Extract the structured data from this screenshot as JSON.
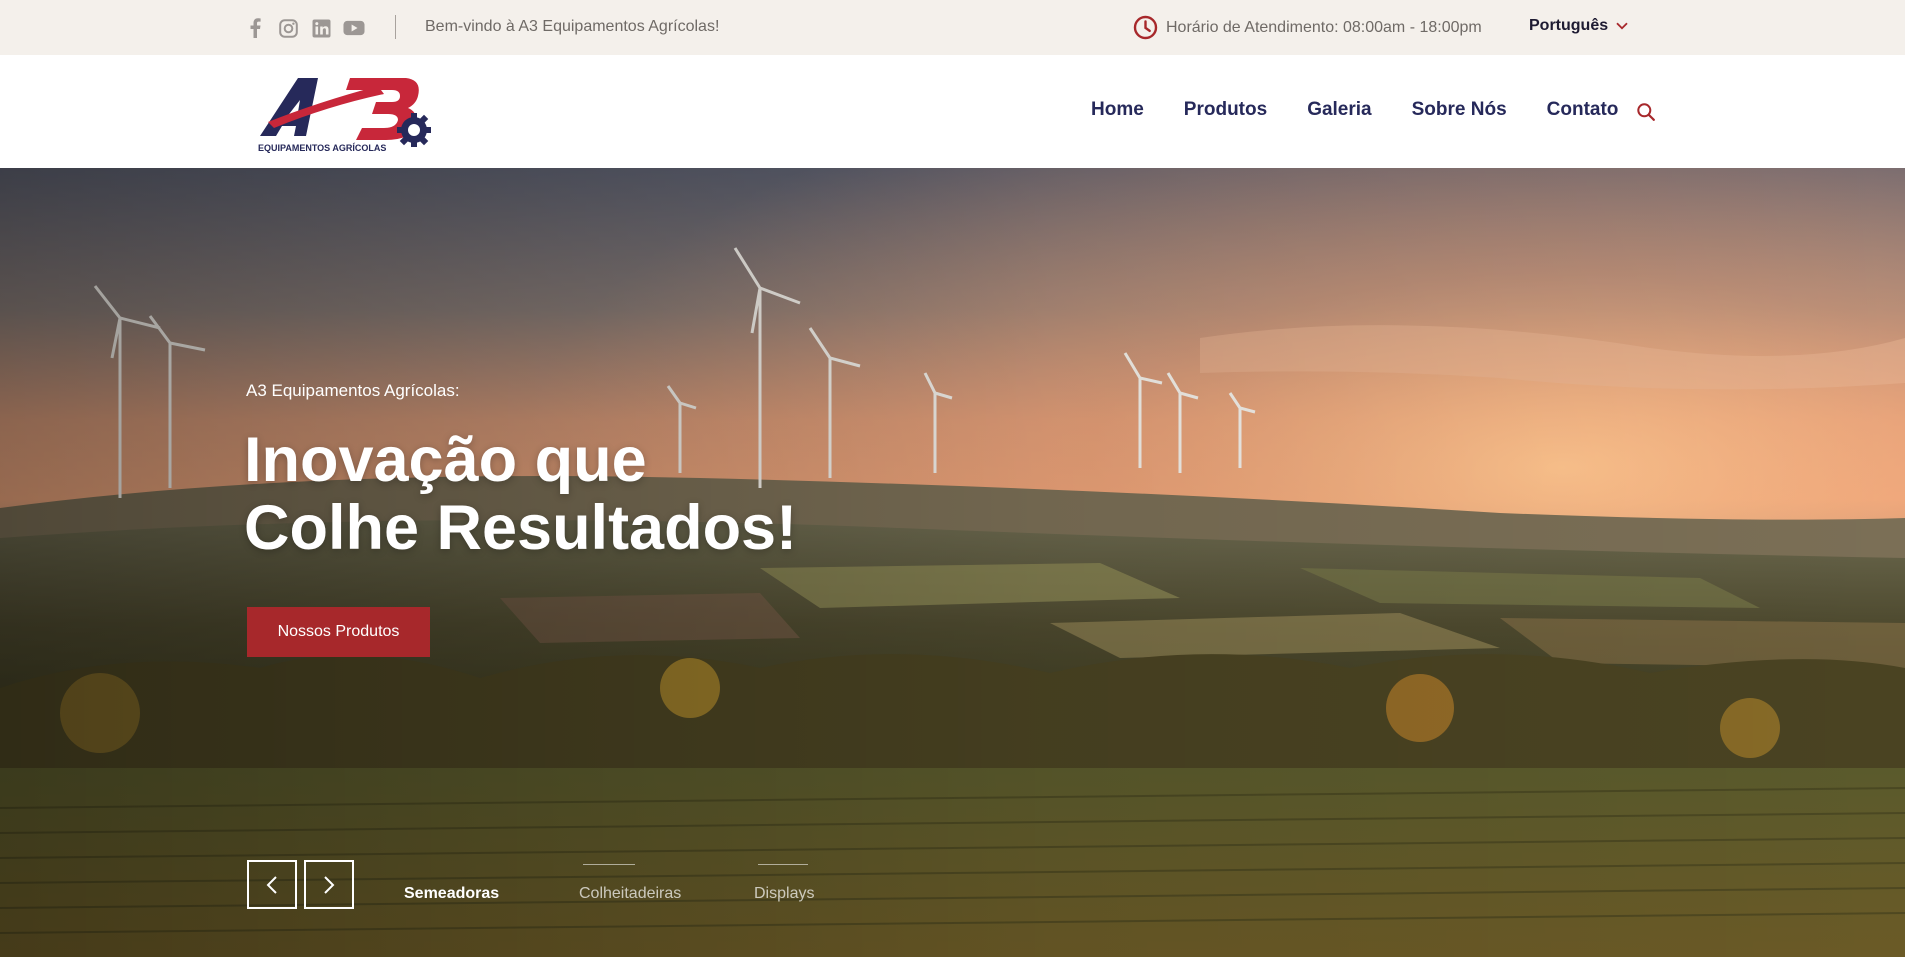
{
  "topbar": {
    "social": [
      {
        "icon": "facebook-icon"
      },
      {
        "icon": "instagram-icon"
      },
      {
        "icon": "linkedin-icon"
      },
      {
        "icon": "youtube-icon"
      }
    ],
    "welcome": "Bem-vindo à A3 Equipamentos Agrícolas!",
    "hours": "Horário de Atendimento: 08:00am - 18:00pm",
    "language": "Português"
  },
  "logo": {
    "text": "A3",
    "tagline": "EQUIPAMENTOS AGRÍCOLAS"
  },
  "nav": {
    "items": [
      "Home",
      "Produtos",
      "Galeria",
      "Sobre Nós",
      "Contato"
    ]
  },
  "hero": {
    "subtitle": "A3 Equipamentos Agrícolas:",
    "title_line1": "Inovação que",
    "title_line2": "Colhe Resultados!",
    "cta": "Nossos Produtos",
    "tabs": [
      "Semeadoras",
      "Colheitadeiras",
      "Displays"
    ],
    "active_tab": 0
  },
  "colors": {
    "topbar_bg": "#f4f0eb",
    "brand_navy": "#26295a",
    "brand_red": "#a7282b",
    "text_muted": "#6f6a66"
  }
}
